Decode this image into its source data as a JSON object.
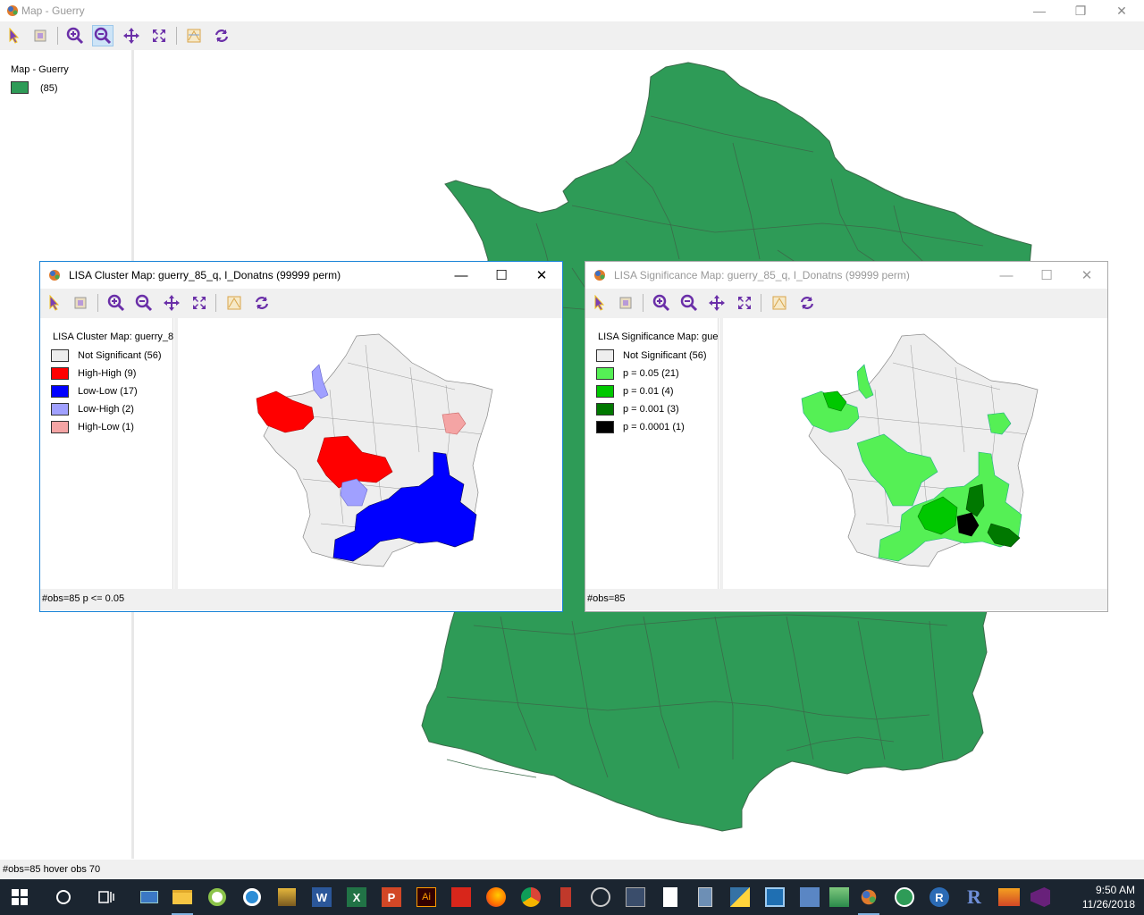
{
  "main_window": {
    "title": "Map - Guerry",
    "legend": {
      "title": "Map - Guerry",
      "items": [
        {
          "label": "(85)",
          "color": "#2e9b57"
        }
      ]
    },
    "status": "#obs=85 hover obs 70",
    "fill_color": "#2e9b57",
    "border_color": "#3b6b4a"
  },
  "cluster_window": {
    "title": "LISA Cluster Map: guerry_85_q, I_Donatns (99999 perm)",
    "legend_title": "LISA Cluster Map: guerry_8",
    "legend": [
      {
        "label": "Not Significant (56)",
        "color": "#eeeeee"
      },
      {
        "label": "High-High (9)",
        "color": "#ff0000"
      },
      {
        "label": "Low-Low (17)",
        "color": "#0000ff"
      },
      {
        "label": "Low-High (2)",
        "color": "#a0a0ff"
      },
      {
        "label": "High-Low (1)",
        "color": "#f4a4a4"
      }
    ],
    "status": "#obs=85  p <= 0.05"
  },
  "significance_window": {
    "title": "LISA Significance Map: guerry_85_q, I_Donatns (99999 perm)",
    "legend_title": "LISA Significance Map: gue",
    "legend": [
      {
        "label": "Not Significant (56)",
        "color": "#eeeeee"
      },
      {
        "label": "p = 0.05 (21)",
        "color": "#55f055"
      },
      {
        "label": "p = 0.01 (4)",
        "color": "#00c800"
      },
      {
        "label": "p = 0.001 (3)",
        "color": "#007800"
      },
      {
        "label": "p = 0.0001 (1)",
        "color": "#000000"
      }
    ],
    "status": "#obs=85"
  },
  "toolbar_icons": [
    "select-icon",
    "select-all-icon",
    "zoom-in-icon",
    "zoom-out-icon",
    "pan-icon",
    "fit-extent-icon",
    "map-layer-icon",
    "refresh-icon"
  ],
  "taskbar": {
    "time": "9:50 AM",
    "date": "11/26/2018",
    "apps": [
      "start-icon",
      "search-icon",
      "task-view-icon",
      "app-icon",
      "file-explorer-icon",
      "qgis-icon",
      "search-tool-icon",
      "archive-icon",
      "word-icon",
      "excel-icon",
      "powerpoint-icon",
      "illustrator-icon",
      "acrobat-icon",
      "firefox-icon",
      "chrome-icon",
      "app-icon",
      "app-icon",
      "app-icon",
      "file-icon",
      "app-icon",
      "python-icon",
      "app-icon",
      "app-icon",
      "app-icon",
      "geoda-icon",
      "app-icon",
      "r-icon",
      "r-icon",
      "app-icon",
      "visual-studio-icon"
    ]
  }
}
